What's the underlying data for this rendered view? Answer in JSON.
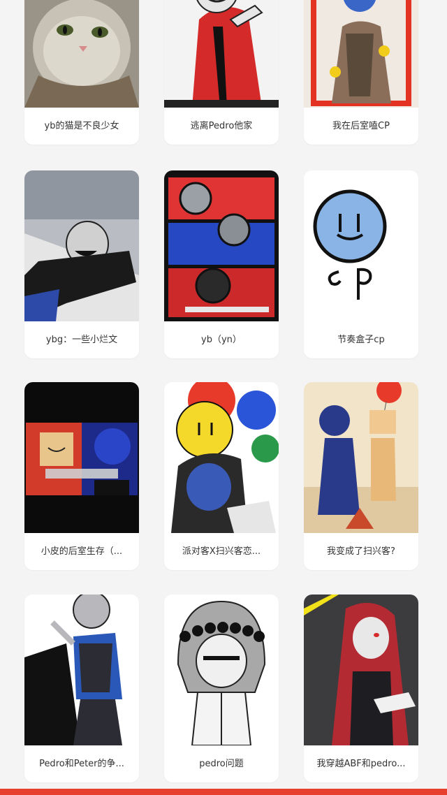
{
  "bottom_bar_color": "#e8402f",
  "cards": [
    {
      "title": "yb的猫是不良少女",
      "image": "kitten-photo"
    },
    {
      "title": "逃离Pedro他家",
      "image": "red-hoodie-character-art"
    },
    {
      "title": "我在后室嗑CP",
      "image": "hooded-character-red-frame-art"
    },
    {
      "title": "ybg：一些小烂文",
      "image": "masked-character-sketch"
    },
    {
      "title": "yb（yn）",
      "image": "comic-collage-art"
    },
    {
      "title": "节奏盒子cp",
      "image": "blue-smiley-drawing"
    },
    {
      "title": "小皮的后室生存（...",
      "image": "rival-meme-art"
    },
    {
      "title": "派对客X扫兴客恋...",
      "image": "balloon-characters-art"
    },
    {
      "title": "我变成了扫兴客?",
      "image": "walking-characters-art"
    },
    {
      "title": "Pedro和Peter的争...",
      "image": "grey-character-blue-hoodie-art"
    },
    {
      "title": "pedro问题",
      "image": "flower-crown-gacha-art"
    },
    {
      "title": "我穿越ABF和pedro...",
      "image": "red-hood-masked-character-art"
    }
  ]
}
